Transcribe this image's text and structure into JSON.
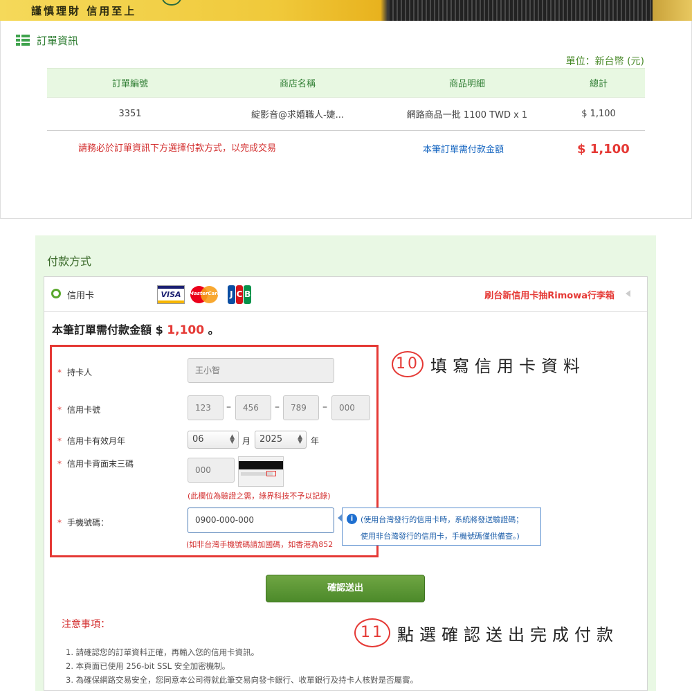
{
  "banner": {
    "slogan": "謹慎理財 信用至上"
  },
  "order": {
    "title": "訂單資訊",
    "unit": "單位：新台幣 (元)",
    "columns": [
      "訂單編號",
      "商店名稱",
      "商品明細",
      "總計"
    ],
    "row": [
      "3351",
      "綻影音@求婚職人-婕...",
      "網路商品一批 1100 TWD x 1",
      "$ 1,100"
    ],
    "warning": "請務必於訂單資訊下方選擇付款方式，以完成交易",
    "need_label": "本筆訂單需付款金額",
    "need_amount": "$ 1,100"
  },
  "payment": {
    "title": "付款方式",
    "method": "信用卡",
    "cards": {
      "visa": "VISA",
      "mastercard": "MasterCard",
      "jcb": [
        "J",
        "C",
        "B"
      ],
      "jcb_colors": [
        "#0b4ea2",
        "#d7141a",
        "#07924a"
      ]
    },
    "promo": "刷台新信用卡抽Rimowa行李箱",
    "amount_prefix": "本筆訂單需付款金額 $",
    "amount_value": "1,100",
    "amount_suffix": "。",
    "fields": {
      "holder_label": "持卡人",
      "holder_value": "王小智",
      "card_label": "信用卡號",
      "card_parts": [
        "123",
        "456",
        "789",
        "000"
      ],
      "expiry_label": "信用卡有效月年",
      "month": "06",
      "month_unit": "月",
      "year": "2025",
      "year_unit": "年",
      "cvv_label": "信用卡背面末三碼",
      "cvv_value": "000",
      "cvv_note": "(此欄位為驗證之需，綠界科技不予以記錄)",
      "phone_label": "手機號碼：",
      "phone_value": "0900-000-000",
      "phone_note": "(如非台灣手機號碼請加國碼，如香港為852"
    },
    "tip": {
      "line1": "(使用台灣發行的信用卡時，系統將發送驗證碼；",
      "line2": "使用非台灣發行的信用卡，手機號碼僅供備查。)"
    },
    "submit": "確認送出",
    "notes_title": "注意事項：",
    "notes": [
      "1. 請確認您的訂單資料正確，再輸入您的信用卡資訊。",
      "2. 本頁面已使用 256-bit SSL 安全加密機制。",
      "3. 為確保網路交易安全，您同意本公司得就此筆交易向發卡銀行、收單銀行及持卡人核對是否屬實。"
    ]
  },
  "annotations": {
    "step10_num": "10",
    "step10_text": "填寫信用卡資料",
    "step11_num": "11",
    "step11_text": "點選確認送出完成付款"
  }
}
